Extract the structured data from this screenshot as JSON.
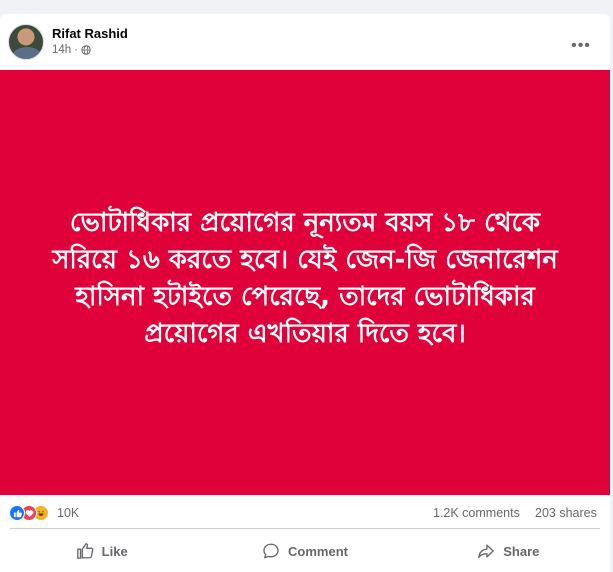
{
  "post": {
    "author": "Rifat Rashid",
    "time": "14h",
    "separator": "·",
    "banner_text": "ভোটাধিকার প্রয়োগের নূন্যতম বয়স ১৮ থেকে সরিয়ে ১৬ করতে হবে। যেই জেন-জি জেনারেশন হাসিনা হটাইতে পেরেছে, তাদের ভোটাধিকার প্রয়োগের এখতিয়ার দিতে হবে।",
    "banner_color": "#e0003a"
  },
  "stats": {
    "reaction_count": "10K",
    "comments": "1.2K comments",
    "shares": "203 shares"
  },
  "actions": {
    "like": "Like",
    "comment": "Comment",
    "share": "Share"
  },
  "icons": [
    "globe-icon",
    "more-icon",
    "like-reaction-icon",
    "love-reaction-icon",
    "haha-reaction-icon",
    "thumbs-up-icon",
    "comment-icon",
    "share-icon"
  ],
  "colors": {
    "like_blue": "#1877f2",
    "love_red": "#f33e58",
    "haha_yellow": "#f7b125"
  }
}
